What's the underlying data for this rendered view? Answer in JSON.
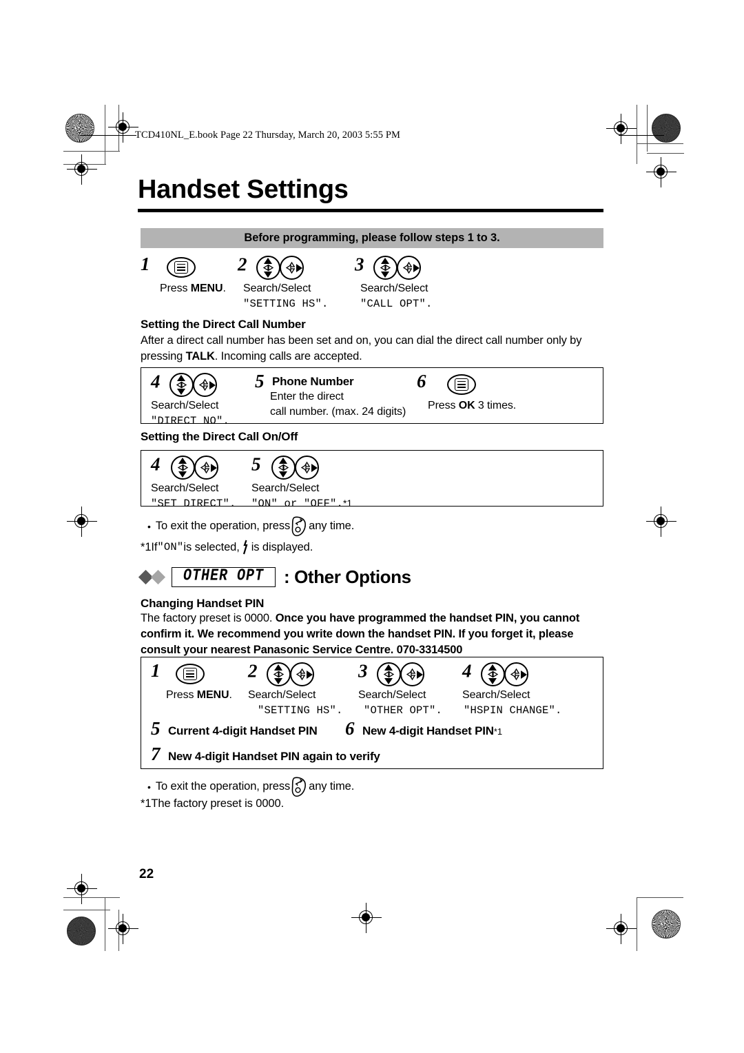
{
  "print_marks": {
    "file_stamp": "TCD410NL_E.book  Page 22  Thursday, March 20, 2003  5:55 PM"
  },
  "page": {
    "title": "Handset Settings",
    "number": "22"
  },
  "banner": {
    "text": "Before programming, please follow steps 1 to 3."
  },
  "intro_steps": [
    {
      "num": "1",
      "icon": "menu-icon",
      "caption": "Press MENU.",
      "caption_plain": "Press ",
      "caption_bold": "MENU",
      "caption_tail": ".",
      "lcd": ""
    },
    {
      "num": "2",
      "icon": "navigator-icon",
      "caption": "Search/Select",
      "lcd": "\"SETTING HS\"."
    },
    {
      "num": "3",
      "icon": "navigator-icon",
      "caption": "Search/Select",
      "lcd": "\"CALL OPT\"."
    }
  ],
  "section_direct_number": {
    "heading": "Setting the Direct Call Number",
    "body_before": "After a direct call number has been set and on, you can dial the direct call number only by pressing ",
    "body_bold": "TALK",
    "body_after": ". Incoming calls are accepted.",
    "steps": [
      {
        "num": "4",
        "icon": "navigator-icon",
        "caption": "Search/Select",
        "lcd": "\"DIRECT NO\"."
      },
      {
        "num": "5",
        "title": "Phone Number",
        "caption_line1": "Enter the direct",
        "caption_line2": "call number. (max. 24 digits)"
      },
      {
        "num": "6",
        "icon": "menu-icon",
        "caption_plain": "Press ",
        "caption_bold": "OK",
        "caption_tail": " 3 times."
      }
    ]
  },
  "section_direct_onoff": {
    "heading": "Setting the Direct Call On/Off",
    "steps": [
      {
        "num": "4",
        "icon": "navigator-icon",
        "caption": "Search/Select",
        "lcd": "\"SET DIRECT\"."
      },
      {
        "num": "5",
        "icon": "navigator-icon",
        "caption": "Search/Select",
        "lcd": "\"ON\" or \"OFF\".",
        "footnote": "*1"
      }
    ],
    "notes": [
      {
        "bullet": "•",
        "before": "To exit the operation, press ",
        "icon": "handset-off-icon",
        "after": " any time."
      }
    ],
    "footnote": {
      "marker": "*1",
      "before": " If ",
      "lcd": "\"ON\"",
      "middle": " is selected, ",
      "icon": "display-indicator-icon",
      "after": " is displayed."
    }
  },
  "other_options": {
    "lcd_label": "OTHER OPT",
    "title": ": Other Options",
    "sub_heading": "Changing Handset PIN",
    "body_normal": "The factory preset is 0000. ",
    "body_bold": "Once you have programmed the handset PIN, you cannot confirm it. We recommend you write down the handset PIN. If you forget it, please consult your nearest Panasonic Service Centre. 070-3314500",
    "steps": [
      {
        "num": "1",
        "icon": "menu-icon",
        "caption_plain": "Press ",
        "caption_bold": "MENU",
        "caption_tail": ".",
        "lcd": ""
      },
      {
        "num": "2",
        "icon": "navigator-icon",
        "caption": "Search/Select",
        "lcd": "\"SETTING HS\"."
      },
      {
        "num": "3",
        "icon": "navigator-icon",
        "caption": "Search/Select",
        "lcd": "\"OTHER OPT\"."
      },
      {
        "num": "4",
        "icon": "navigator-icon",
        "caption": "Search/Select",
        "lcd": "\"HSPIN CHANGE\"."
      }
    ],
    "pin_steps": [
      {
        "num": "5",
        "label": "Current 4-digit Handset PIN"
      },
      {
        "num": "6",
        "label": "New 4-digit Handset PIN",
        "footnote": "*1"
      },
      {
        "num": "7",
        "label": "New 4-digit Handset PIN again to verify"
      }
    ],
    "notes": [
      {
        "bullet": "•",
        "before": "To exit the operation, press ",
        "icon": "handset-off-icon",
        "after": " any time."
      }
    ],
    "footnote": {
      "marker": "*1",
      "text": " The factory preset is 0000."
    }
  },
  "colors": {
    "banner_gray": "#b3b3b3",
    "diamond_dark": "#595959",
    "diamond_light": "#a6a6a6",
    "ink": "#000000"
  }
}
